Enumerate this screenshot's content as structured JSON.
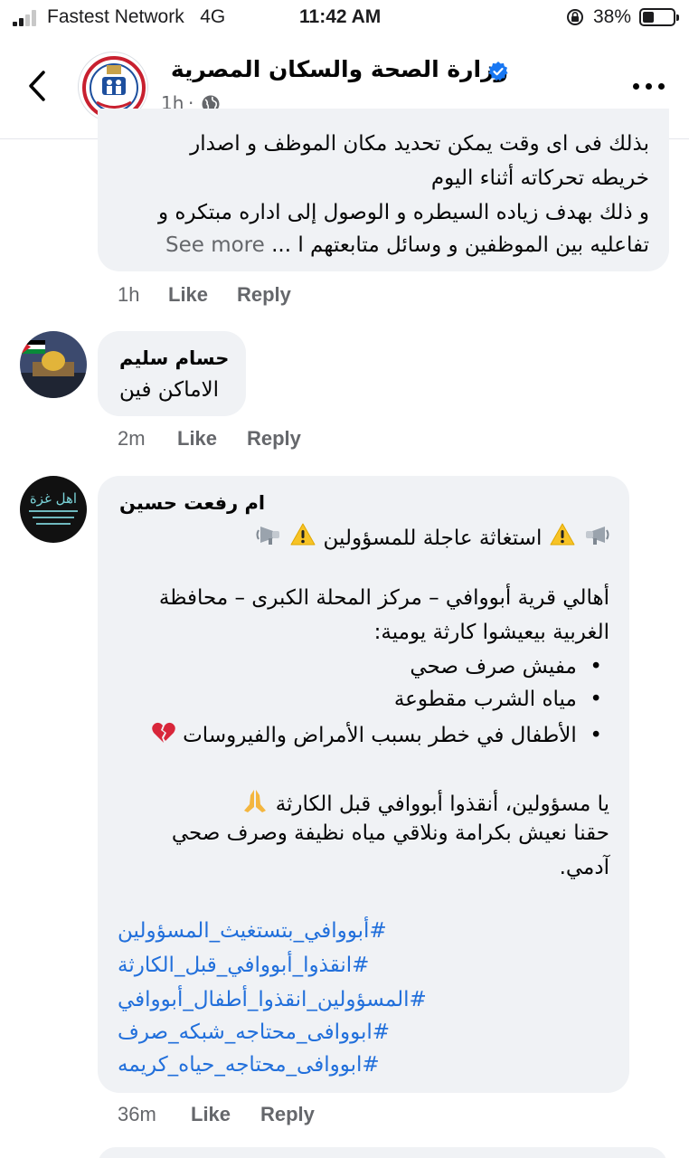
{
  "status_bar": {
    "carrier": "Fastest Network",
    "network": "4G",
    "time": "11:42 AM",
    "battery": "38%",
    "battery_level": 0.38
  },
  "header": {
    "page_name": "وزارة الصحة والسكان المصرية",
    "time_ago": "1h",
    "separator": "·"
  },
  "comments": [
    {
      "author": "",
      "lines": [
        "بذلك فى اى وقت يمكن تحديد مكان الموظف و اصدار",
        "خريطه تحركاته أثناء اليوم",
        "و ذلك بهدف زياده السيطره و الوصول إلى اداره مبتكره و",
        "تفاعليه بين الموظفين و وسائل متابعتهم ا ..."
      ],
      "see_more": "See more",
      "time": "1h",
      "like": "Like",
      "reply": "Reply"
    },
    {
      "author": "حسام سليم",
      "lines": [
        "الاماكن فين"
      ],
      "time": "2m",
      "like": "Like",
      "reply": "Reply"
    },
    {
      "author": "ام رفعت حسين",
      "headline": "استغاثة عاجلة للمسؤولين",
      "lines": [
        "أهالي قرية أبووافي – مركز المحلة الكبرى – محافظة",
        "الغربية بيعيشوا كارثة يومية:",
        "مفيش صرف صحي",
        "مياه الشرب مقطوعة",
        "الأطفال في خطر بسبب الأمراض والفيروسات",
        "يا مسؤولين، أنقذوا أبووافي قبل الكارثة",
        "حقنا نعيش بكرامة ونلاقي مياه نظيفة وصرف صحي",
        "آدمي."
      ],
      "bullet": "•",
      "hashtags": [
        "#أبووافي_بتستغيث_المسؤولين",
        "#انقذوا_أبووافي_قبل_الكارثة",
        "#المسؤولين_انقذوا_أطفال_أبووافي",
        "#ابووافى_محتاجه_شبكه_صرف",
        "#ابووافى_محتاجه_حياه_كريمه"
      ],
      "time": "36m",
      "like": "Like",
      "reply": "Reply"
    }
  ],
  "icons": {
    "back": "chevron-left-icon",
    "verified": "verified-badge-icon",
    "audience": "globe-icon",
    "more": "more-dots-icon",
    "megaphone": "megaphone-icon",
    "warning": "warning-icon",
    "broken_heart": "broken-heart-icon",
    "pray": "folded-hands-icon"
  },
  "colors": {
    "link": "#216fdb",
    "bubble": "#f0f2f5",
    "meta": "#65676b",
    "verified": "#1877f2"
  }
}
